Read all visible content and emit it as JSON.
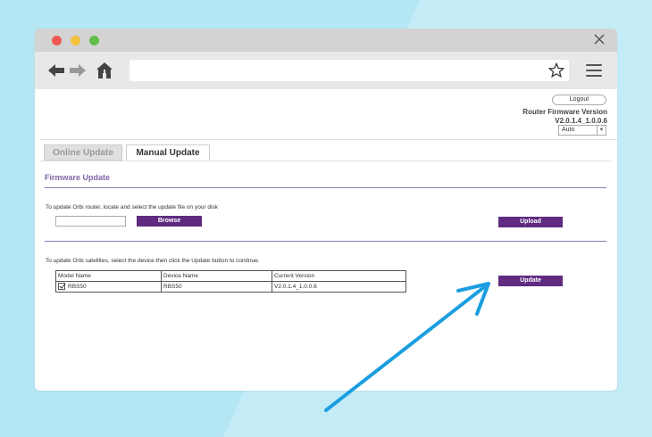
{
  "colors": {
    "background": "#b5e6f3",
    "accent_purple": "#5f2b80",
    "section_title": "#8067a8",
    "annotation_arrow": "#1a9ee0"
  },
  "browser": {
    "window_controls": [
      "red-dot",
      "yellow-dot",
      "green-dot"
    ],
    "icons": [
      "back-arrow-icon",
      "forward-arrow-icon",
      "home-icon",
      "star-icon",
      "hamburger-menu-icon",
      "close-icon"
    ],
    "url": ""
  },
  "header": {
    "logout_label": "Logout",
    "fw_label": "Router Firmware Version",
    "fw_value": "V2.0.1.4_1.0.0.6",
    "auto_select": "Auto"
  },
  "tabs": [
    {
      "label": "Online Update",
      "active": false
    },
    {
      "label": "Manual Update",
      "active": true
    }
  ],
  "firmware": {
    "title": "Firmware Update",
    "router_instruction": "To update Orbi router, locate and select the update file on your disk",
    "file_value": "",
    "browse_label": "Browse",
    "upload_label": "Upload",
    "satellite_instruction": "To update Orbi satellites, select the device then click the Update button to continue.",
    "update_label": "Update"
  },
  "satellite_table": {
    "headers": [
      "Model Name",
      "Device Name",
      "Current Version"
    ],
    "rows": [
      {
        "checked": true,
        "model": "RBS50",
        "device": "RBS50",
        "version": "V2.0.1.4_1.0.0.6"
      }
    ]
  }
}
